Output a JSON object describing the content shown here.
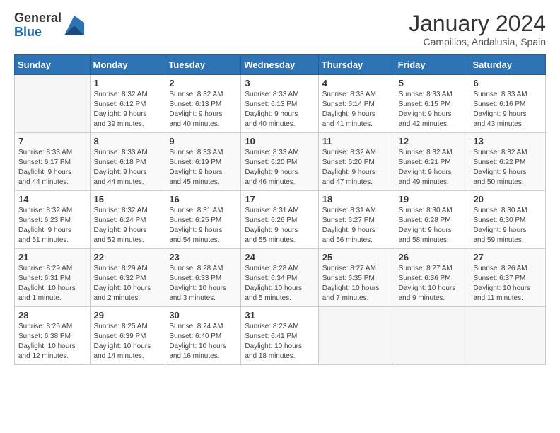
{
  "logo": {
    "general": "General",
    "blue": "Blue"
  },
  "title": {
    "month_year": "January 2024",
    "location": "Campillos, Andalusia, Spain"
  },
  "headers": [
    "Sunday",
    "Monday",
    "Tuesday",
    "Wednesday",
    "Thursday",
    "Friday",
    "Saturday"
  ],
  "weeks": [
    [
      {
        "day": "",
        "info": ""
      },
      {
        "day": "1",
        "info": "Sunrise: 8:32 AM\nSunset: 6:12 PM\nDaylight: 9 hours\nand 39 minutes."
      },
      {
        "day": "2",
        "info": "Sunrise: 8:32 AM\nSunset: 6:13 PM\nDaylight: 9 hours\nand 40 minutes."
      },
      {
        "day": "3",
        "info": "Sunrise: 8:33 AM\nSunset: 6:13 PM\nDaylight: 9 hours\nand 40 minutes."
      },
      {
        "day": "4",
        "info": "Sunrise: 8:33 AM\nSunset: 6:14 PM\nDaylight: 9 hours\nand 41 minutes."
      },
      {
        "day": "5",
        "info": "Sunrise: 8:33 AM\nSunset: 6:15 PM\nDaylight: 9 hours\nand 42 minutes."
      },
      {
        "day": "6",
        "info": "Sunrise: 8:33 AM\nSunset: 6:16 PM\nDaylight: 9 hours\nand 43 minutes."
      }
    ],
    [
      {
        "day": "7",
        "info": "Sunrise: 8:33 AM\nSunset: 6:17 PM\nDaylight: 9 hours\nand 44 minutes."
      },
      {
        "day": "8",
        "info": "Sunrise: 8:33 AM\nSunset: 6:18 PM\nDaylight: 9 hours\nand 44 minutes."
      },
      {
        "day": "9",
        "info": "Sunrise: 8:33 AM\nSunset: 6:19 PM\nDaylight: 9 hours\nand 45 minutes."
      },
      {
        "day": "10",
        "info": "Sunrise: 8:33 AM\nSunset: 6:20 PM\nDaylight: 9 hours\nand 46 minutes."
      },
      {
        "day": "11",
        "info": "Sunrise: 8:32 AM\nSunset: 6:20 PM\nDaylight: 9 hours\nand 47 minutes."
      },
      {
        "day": "12",
        "info": "Sunrise: 8:32 AM\nSunset: 6:21 PM\nDaylight: 9 hours\nand 49 minutes."
      },
      {
        "day": "13",
        "info": "Sunrise: 8:32 AM\nSunset: 6:22 PM\nDaylight: 9 hours\nand 50 minutes."
      }
    ],
    [
      {
        "day": "14",
        "info": "Sunrise: 8:32 AM\nSunset: 6:23 PM\nDaylight: 9 hours\nand 51 minutes."
      },
      {
        "day": "15",
        "info": "Sunrise: 8:32 AM\nSunset: 6:24 PM\nDaylight: 9 hours\nand 52 minutes."
      },
      {
        "day": "16",
        "info": "Sunrise: 8:31 AM\nSunset: 6:25 PM\nDaylight: 9 hours\nand 54 minutes."
      },
      {
        "day": "17",
        "info": "Sunrise: 8:31 AM\nSunset: 6:26 PM\nDaylight: 9 hours\nand 55 minutes."
      },
      {
        "day": "18",
        "info": "Sunrise: 8:31 AM\nSunset: 6:27 PM\nDaylight: 9 hours\nand 56 minutes."
      },
      {
        "day": "19",
        "info": "Sunrise: 8:30 AM\nSunset: 6:28 PM\nDaylight: 9 hours\nand 58 minutes."
      },
      {
        "day": "20",
        "info": "Sunrise: 8:30 AM\nSunset: 6:30 PM\nDaylight: 9 hours\nand 59 minutes."
      }
    ],
    [
      {
        "day": "21",
        "info": "Sunrise: 8:29 AM\nSunset: 6:31 PM\nDaylight: 10 hours\nand 1 minute."
      },
      {
        "day": "22",
        "info": "Sunrise: 8:29 AM\nSunset: 6:32 PM\nDaylight: 10 hours\nand 2 minutes."
      },
      {
        "day": "23",
        "info": "Sunrise: 8:28 AM\nSunset: 6:33 PM\nDaylight: 10 hours\nand 3 minutes."
      },
      {
        "day": "24",
        "info": "Sunrise: 8:28 AM\nSunset: 6:34 PM\nDaylight: 10 hours\nand 5 minutes."
      },
      {
        "day": "25",
        "info": "Sunrise: 8:27 AM\nSunset: 6:35 PM\nDaylight: 10 hours\nand 7 minutes."
      },
      {
        "day": "26",
        "info": "Sunrise: 8:27 AM\nSunset: 6:36 PM\nDaylight: 10 hours\nand 9 minutes."
      },
      {
        "day": "27",
        "info": "Sunrise: 8:26 AM\nSunset: 6:37 PM\nDaylight: 10 hours\nand 11 minutes."
      }
    ],
    [
      {
        "day": "28",
        "info": "Sunrise: 8:25 AM\nSunset: 6:38 PM\nDaylight: 10 hours\nand 12 minutes."
      },
      {
        "day": "29",
        "info": "Sunrise: 8:25 AM\nSunset: 6:39 PM\nDaylight: 10 hours\nand 14 minutes."
      },
      {
        "day": "30",
        "info": "Sunrise: 8:24 AM\nSunset: 6:40 PM\nDaylight: 10 hours\nand 16 minutes."
      },
      {
        "day": "31",
        "info": "Sunrise: 8:23 AM\nSunset: 6:41 PM\nDaylight: 10 hours\nand 18 minutes."
      },
      {
        "day": "",
        "info": ""
      },
      {
        "day": "",
        "info": ""
      },
      {
        "day": "",
        "info": ""
      }
    ]
  ]
}
